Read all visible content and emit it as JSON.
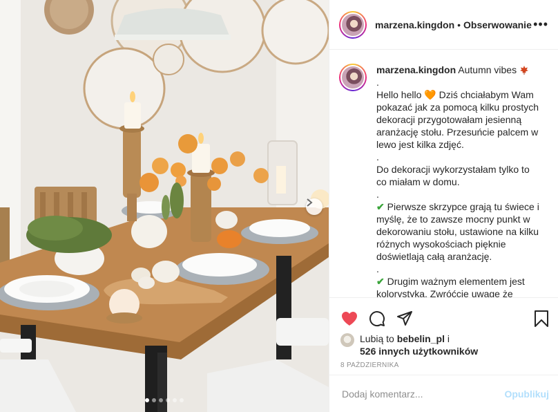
{
  "post": {
    "username": "marzena.kingdon",
    "separator": "•",
    "follow_label": "Obserwowanie",
    "more_icon": "more-options-icon"
  },
  "caption": {
    "username": "marzena.kingdon",
    "title": "Autumn vibes",
    "title_icon": "maple-leaf-icon",
    "paragraphs": [
      ".",
      "Hello hello",
      "Dziś chciałabym Wam pokazać jak za pomocą kilku prostych dekoracji przygotowałam jesienną aranżację stołu. Przesuńcie palcem w lewo jest kilka zdjęć.",
      ".",
      "Do dekoracji wykorzystałam tylko to co miałam w domu.",
      ".",
      "Pierwsze skrzypce grają tu świece i myślę, że to zawsze mocny punkt w dekorowaniu stołu, ustawione na kilku różnych wysokościach pięknie doświetlają całą aranżację.",
      ".",
      "Drugim ważnym elementem jest",
      "kolorystyka. Zwróćcie uwagę że"
    ],
    "heart_emoji": "🧡",
    "check_emoji": "✔"
  },
  "actions": {
    "like_icon": "heart-icon",
    "comment_icon": "comment-icon",
    "share_icon": "share-icon",
    "save_icon": "bookmark-icon",
    "like_color": "#ed4956"
  },
  "likes": {
    "prefix": "Lubią to",
    "user": "bebelin_pl",
    "and": "i",
    "others": "526 innych użytkowników"
  },
  "date": "8 PAŹDZIERNIKA",
  "comment": {
    "placeholder": "Dodaj komentarz...",
    "publish_label": "Opublikuj",
    "publish_color": "#b2dffc"
  },
  "carousel": {
    "total_slides": 6,
    "active_slide": 1
  }
}
